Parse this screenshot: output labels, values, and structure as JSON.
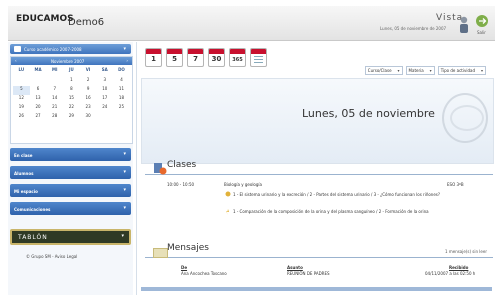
{
  "header": {
    "logo_text": "EDUCAMOS",
    "app_title": "Demo6",
    "view_label": "Vista",
    "date_text": "Lunes, 05 de noviembre de 2007",
    "exit_label": "Salir"
  },
  "sidebar": {
    "course_label": "Curso académico 2007-2008",
    "calendar": {
      "month": "Noviembre 2007",
      "weekdays": [
        "LU",
        "MA",
        "MI",
        "JU",
        "VI",
        "SA",
        "DO"
      ],
      "weeks": [
        [
          "",
          "",
          "",
          "1",
          "2",
          "3",
          "4"
        ],
        [
          "5",
          "6",
          "7",
          "8",
          "9",
          "10",
          "11"
        ],
        [
          "12",
          "13",
          "14",
          "15",
          "16",
          "17",
          "18"
        ],
        [
          "19",
          "20",
          "21",
          "22",
          "23",
          "24",
          "25"
        ],
        [
          "26",
          "27",
          "28",
          "29",
          "30",
          "",
          ""
        ]
      ]
    },
    "menu": [
      {
        "label": "En clase"
      },
      {
        "label": "Alumnos"
      },
      {
        "label": "Mi espacio"
      },
      {
        "label": "Comunicaciones"
      }
    ],
    "tablon_label": "TABLÓN",
    "copyright": "© Grupo SM - Aviso Legal"
  },
  "toolbar": {
    "day_buttons": [
      "1",
      "5",
      "7",
      "30",
      "365"
    ]
  },
  "filters": {
    "course": "Curso/Clase",
    "subject": "Materia",
    "activity_type": "Tipo de actividad"
  },
  "main": {
    "day_title": "Lunes, 05 de noviembre"
  },
  "clases": {
    "title": "Clases",
    "time": "10:00 - 10:50",
    "subject": "Biología y geología",
    "group": "ESO 3ºB",
    "items": [
      "1 - El sistema urinario y la excreción / 2 - Partes del sistema urinario / 3 - ¿Cómo funcionan los riñones?",
      "1 - Comparación de la composición de la orina y del plasma sanguíneo / 2 - Formación de la orina"
    ]
  },
  "mensajes": {
    "title": "Mensajes",
    "count_text": "1 mensaje(s) sin leer",
    "columns": {
      "from": "De",
      "subject": "Asunto",
      "received": "Recibido"
    },
    "rows": [
      {
        "from": "Ana Ancochea Toscano",
        "subject": "REUNIÓN DE PADRES",
        "received": "04/11/2007 a las 02:50 h"
      }
    ]
  }
}
